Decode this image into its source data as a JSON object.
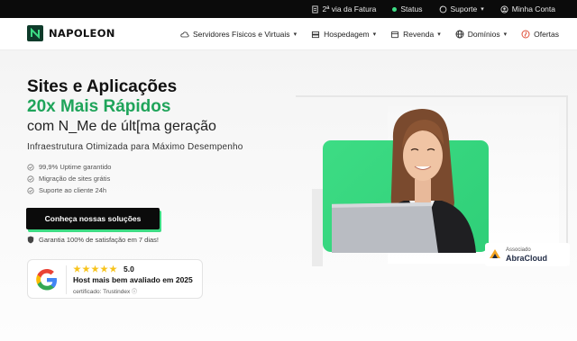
{
  "topbar": {
    "items": [
      {
        "label": "2ª via da Fatura",
        "icon": "invoice-icon"
      },
      {
        "label": "Status",
        "icon": "status-dot-icon",
        "color": "#3ddc84"
      },
      {
        "label": "Suporte",
        "icon": "support-icon"
      },
      {
        "label": "Minha Conta",
        "icon": "user-icon"
      }
    ]
  },
  "nav": {
    "brand": "NAPOLEON",
    "menu": [
      {
        "label": "Servidores Físicos e Virtuais",
        "icon": "cloud-icon"
      },
      {
        "label": "Hospedagem",
        "icon": "server-icon"
      },
      {
        "label": "Revenda",
        "icon": "reseller-icon"
      },
      {
        "label": "Domínios",
        "icon": "globe-icon"
      },
      {
        "label": "Ofertas",
        "icon": "tag-icon"
      }
    ]
  },
  "hero": {
    "title_line1": "Sites e Aplicações",
    "title_line2": "20x Mais Rápidos",
    "title_line3": "com N_Me de últ[ma geração",
    "subtitle": "Infraestrutura Otimizada para Máximo Desempenho",
    "features": [
      "99,9% Uptime garantido",
      "Migração de sites grátis",
      "Suporte ao cliente 24h"
    ],
    "cta_label": "Conheça nossas soluções",
    "guarantee": "Garantia 100% de satisfação em 7 dias!",
    "accent_color": "#1fa45a"
  },
  "review_card": {
    "rating": "5.0",
    "stars": 5,
    "title": "Host mais bem avaliado em 2025",
    "certified": "certificado: Trustindex"
  },
  "badge": {
    "line1": "Associado",
    "line2": "AbraCloud"
  }
}
